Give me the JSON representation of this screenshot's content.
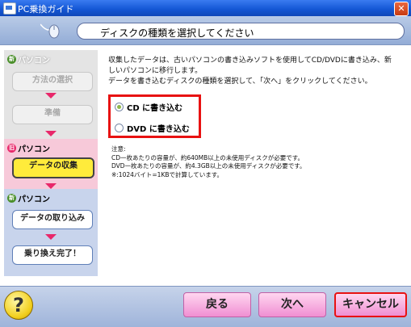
{
  "window": {
    "title": "PC乗換ガイド"
  },
  "header": {
    "title": "ディスクの種類を選択してください"
  },
  "steps": {
    "new_pc_label": "パソコン",
    "new_badge": "新",
    "old_pc_label": "パソコン",
    "old_badge": "旧",
    "items": [
      {
        "label": "方法の選択",
        "state": "done"
      },
      {
        "label": "準備",
        "state": "done"
      },
      {
        "label": "データの収集",
        "state": "active"
      },
      {
        "label": "データの取り込み",
        "state": "pending"
      },
      {
        "label": "乗り換え完了！",
        "state": "pending"
      }
    ]
  },
  "main": {
    "description_line1": "収集したデータは、古いパソコンの書き込みソフトを使用してCD/DVDに書き込み、新",
    "description_line2": "しいパソコンに移行します。",
    "description_line3": "データを書き込むディスクの種類を選択して、「次へ」をクリックしてください。",
    "options": [
      {
        "label": "CD に書き込む",
        "selected": true
      },
      {
        "label": "DVD に書き込む",
        "selected": false
      }
    ],
    "notes_title": "注意:",
    "notes": [
      "CD一枚あたりの容量が、約640MB以上の未使用ディスクが必要です。",
      "DVD一枚あたりの容量が、約4.3GB以上の未使用ディスクが必要です。",
      "※:1024バイト=1KBで計算しています。"
    ]
  },
  "footer": {
    "help_label": "?",
    "back_label": "戻る",
    "next_label": "次へ",
    "cancel_label": "キャンセル"
  },
  "colors": {
    "accent_red": "#e81212",
    "new_badge": "#4a8f2a",
    "old_badge": "#e8286a",
    "step_arrow": "#e8286a"
  }
}
